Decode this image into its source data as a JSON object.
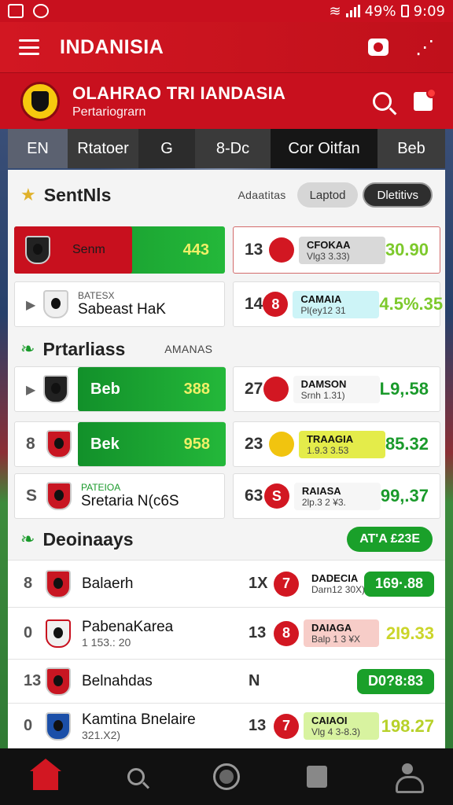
{
  "status": {
    "battery": "49%",
    "time": "9:09"
  },
  "app": {
    "title": "INDANISIA"
  },
  "brand": {
    "title": "OLAHRAO TRI IANDASIA",
    "subtitle": "Pertariograrn"
  },
  "tabs": [
    "EN",
    "Rtatoer",
    "G",
    "8-Dc",
    "Cor Oitfan",
    "Beb"
  ],
  "section1": {
    "title": "SentNls",
    "label": "Adaatitas",
    "pill_light": "Laptod",
    "pill_dark": "Dletitivs"
  },
  "left1": [
    {
      "name": "Senm",
      "value": "443"
    },
    {
      "small": "BATESX",
      "name": "Sabeast HaK"
    }
  ],
  "right1": [
    {
      "num": "13",
      "badge": "",
      "title": "CFOKAA",
      "sub": "Vlg3 3.33)",
      "value": "30.90"
    },
    {
      "num": "14",
      "badge": "8",
      "title": "CAMAIA",
      "sub": "Pl(ey12 31",
      "value": "4.5%.35"
    }
  ],
  "section2": {
    "title": "Prtarliass",
    "label": "AMANAS"
  },
  "left2": [
    {
      "rank": "",
      "name": "Beb",
      "value": "388"
    },
    {
      "rank": "8",
      "name": "Bek",
      "value": "958"
    },
    {
      "rank": "S",
      "small": "PATEIOA",
      "name": "Sretaria N(c6S"
    }
  ],
  "right2": [
    {
      "num": "27",
      "badge": "",
      "title": "DAMSON",
      "sub": "Srnh 1.31)",
      "value": "L9,.58"
    },
    {
      "num": "23",
      "badge": "",
      "title": "TRAAGIA",
      "sub": "1.9.3 3.53",
      "value": "85.32"
    },
    {
      "num": "63",
      "badge": "S",
      "title": "RAIASA",
      "sub": "2lp.3 2 ¥3.",
      "value": "99,.37"
    }
  ],
  "section3": {
    "title": "Deoinaays",
    "pill": "AT'A £23E"
  },
  "rows3": [
    {
      "rank": "8",
      "name": "Balaerh",
      "sub": "",
      "mid": "1X",
      "badge": "7",
      "title": "DADECIA",
      "bsub": "Darn12 30X)",
      "value": "169·.88",
      "pill": true
    },
    {
      "rank": "0",
      "name": "PabenaKarea",
      "sub": "1 153.: 20",
      "mid": "13",
      "badge": "8",
      "title": "DAIAGA",
      "bsub": "Balp 1 3 ¥X",
      "value": "2I9.33",
      "pill": false
    },
    {
      "rank": "13",
      "name": "Belnahdas",
      "sub": "",
      "mid": "N",
      "badge": "",
      "title": "",
      "bsub": "",
      "value": "D0?8:83",
      "pill": true
    },
    {
      "rank": "0",
      "name": "Kamtina Bnelaire",
      "sub": "321.X2)",
      "mid": "13",
      "badge": "7",
      "title": "CAIAOI",
      "bsub": "Vlg 4 3-8.3)",
      "value": "198.27",
      "pill": false
    }
  ],
  "bottom_nav": [
    "home-icon",
    "search-icon",
    "circle-icon",
    "square-icon",
    "profile-icon"
  ]
}
